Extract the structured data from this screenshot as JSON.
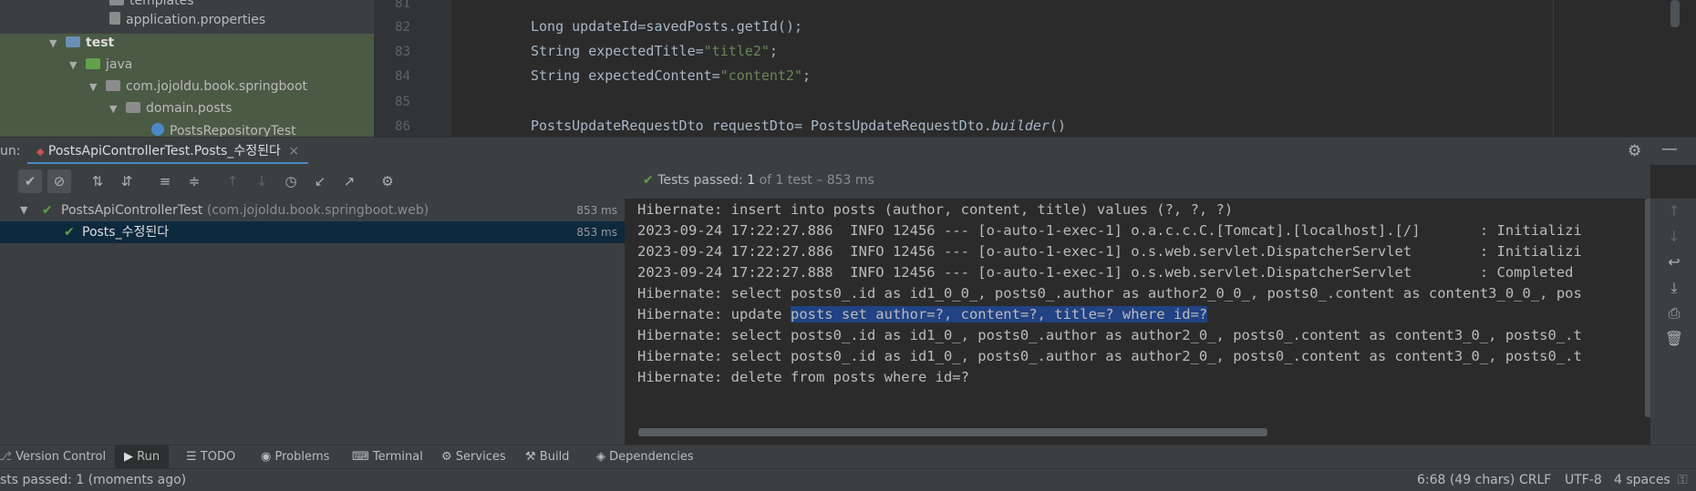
{
  "project_tree": {
    "items": [
      {
        "label": "templates"
      },
      {
        "label": "application.properties"
      },
      {
        "label": "test"
      },
      {
        "label": "java"
      },
      {
        "label": "com.jojoldu.book.springboot"
      },
      {
        "label": "domain.posts"
      },
      {
        "label": "PostsRepositoryTest"
      }
    ]
  },
  "editor": {
    "line_numbers": [
      "81",
      "82",
      "83",
      "84",
      "85",
      "86"
    ],
    "lines": [
      {
        "pre": "",
        "str": "",
        "post": ""
      },
      {
        "pre": "Long updateId=savedPosts.getId();",
        "str": "",
        "post": ""
      },
      {
        "pre": "String expectedTitle=",
        "str": "\"title2\"",
        "post": ";"
      },
      {
        "pre": "String expectedContent=",
        "str": "\"content2\"",
        "post": ";"
      },
      {
        "pre": "",
        "str": "",
        "post": ""
      },
      {
        "pre": "PostsUpdateRequestDto requestDto= PostsUpdateRequestDto.",
        "italic": "builder",
        "post2": "()"
      }
    ]
  },
  "run": {
    "label": "un:",
    "tab_label": "PostsApiControllerTest.Posts_수정된다",
    "tab_close": "×",
    "status_prefix": "Tests passed:",
    "status_count": "1",
    "status_suffix": "of 1 test – 853 ms",
    "tree": [
      {
        "name": "PostsApiControllerTest",
        "pkg": "(com.jojoldu.book.springboot.web)",
        "time": "853 ms"
      },
      {
        "name": "Posts_수정된다",
        "time": "853 ms"
      }
    ]
  },
  "console": {
    "lines": [
      "Hibernate: insert into posts (author, content, title) values (?, ?, ?)",
      "2023-09-24 17:22:27.886  INFO 12456 --- [o-auto-1-exec-1] o.a.c.c.C.[Tomcat].[localhost].[/]       : Initializi",
      "2023-09-24 17:22:27.886  INFO 12456 --- [o-auto-1-exec-1] o.s.web.servlet.DispatcherServlet        : Initializi",
      "2023-09-24 17:22:27.888  INFO 12456 --- [o-auto-1-exec-1] o.s.web.servlet.DispatcherServlet        : Completed",
      "Hibernate: select posts0_.id as id1_0_0_, posts0_.author as author2_0_0_, posts0_.content as content3_0_0_, pos",
      "",
      "Hibernate: select posts0_.id as id1_0_, posts0_.author as author2_0_, posts0_.content as content3_0_, posts0_.t",
      "Hibernate: select posts0_.id as id1_0_, posts0_.author as author2_0_, posts0_.content as content3_0_, posts0_.t",
      "Hibernate: delete from posts where id=?"
    ],
    "update_prefix": "Hibernate: update ",
    "update_selected": "posts set author=?, content=?, title=? where id=?"
  },
  "tool_windows": [
    {
      "label": "Version Control"
    },
    {
      "label": "Run"
    },
    {
      "label": "TODO"
    },
    {
      "label": "Problems"
    },
    {
      "label": "Terminal"
    },
    {
      "label": "Services"
    },
    {
      "label": "Build"
    },
    {
      "label": "Dependencies"
    }
  ],
  "status_bar": {
    "message": "sts passed: 1 (moments ago)",
    "position": "6:68 (49 chars)",
    "line_sep": "CRLF",
    "encoding": "UTF-8",
    "indent": "4 spaces"
  },
  "colors": {
    "accent": "#4a88c7",
    "pass": "#5f9f48",
    "selection": "#214283"
  }
}
